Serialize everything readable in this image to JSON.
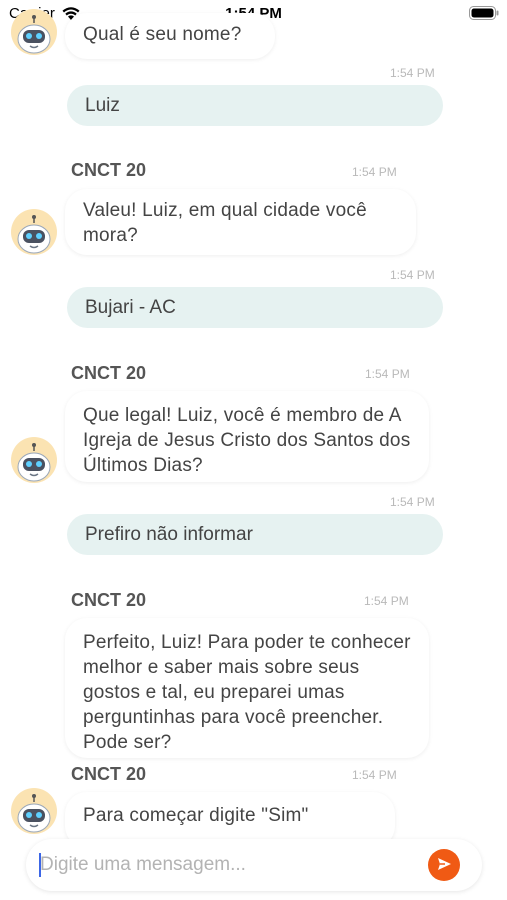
{
  "status_bar": {
    "carrier": "Carrier",
    "time": "1:54 PM"
  },
  "messages": [
    {
      "type": "bot",
      "text": "Qual é seu nome?"
    },
    {
      "type": "user",
      "time": "1:54 PM",
      "text": "Luiz"
    },
    {
      "type": "bot",
      "sender": "CNCT 20",
      "time": "1:54 PM",
      "text": "Valeu! Luiz, em qual cidade você mora?"
    },
    {
      "type": "user",
      "time": "1:54 PM",
      "text": "Bujari - AC"
    },
    {
      "type": "bot",
      "sender": "CNCT 20",
      "time": "1:54 PM",
      "text": "Que legal! Luiz, você é membro de A Igreja de Jesus Cristo dos Santos dos Últimos Dias?"
    },
    {
      "type": "user",
      "time": "1:54 PM",
      "text": "Prefiro não informar"
    },
    {
      "type": "bot",
      "sender": "CNCT 20",
      "time": "1:54 PM",
      "text": "Perfeito, Luiz! Para poder te conhecer melhor e saber mais sobre seus gostos e tal, eu preparei umas perguntinhas para você preencher. Pode ser?"
    },
    {
      "type": "bot",
      "sender": "CNCT 20",
      "time": "1:54 PM",
      "text": "Para começar digite \"Sim\""
    }
  ],
  "composer": {
    "placeholder": "Digite uma mensagem..."
  },
  "icons": {
    "send": "send-icon",
    "avatar": "robot-avatar-icon",
    "wifi": "wifi-icon",
    "battery": "battery-icon"
  },
  "colors": {
    "accent": "#f05a14",
    "user_bubble": "#e6f2f1",
    "avatar_bg": "#fbe3b2"
  }
}
